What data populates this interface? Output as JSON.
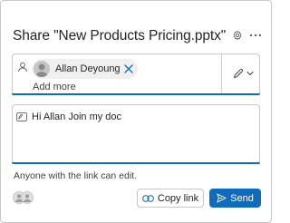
{
  "dialog": {
    "title": "Share \"New Products Pricing.pptx\"",
    "settings_icon": "gear-icon",
    "more_icon": "more-horizontal-icon"
  },
  "recipients": {
    "label_icon": "person-icon",
    "chips": [
      {
        "name": "Allan Deyoung",
        "avatar_icon": "avatar",
        "remove_icon": "close-icon"
      }
    ],
    "add_more_placeholder": "Add more",
    "permission_icon": "pencil-icon",
    "permission_dropdown_icon": "chevron-down-icon"
  },
  "message": {
    "icon": "message-icon",
    "text": "Hi Allan Join my doc"
  },
  "link_info": "Anyone with the link can edit.",
  "footer": {
    "shared_with_icon": "people-avatars-icon",
    "copy_link_label": "Copy link",
    "copy_link_icon": "link-icon",
    "send_label": "Send",
    "send_icon": "send-icon"
  },
  "colors": {
    "accent": "#0f6cbd",
    "border": "#c8c8c8",
    "text": "#242424"
  }
}
